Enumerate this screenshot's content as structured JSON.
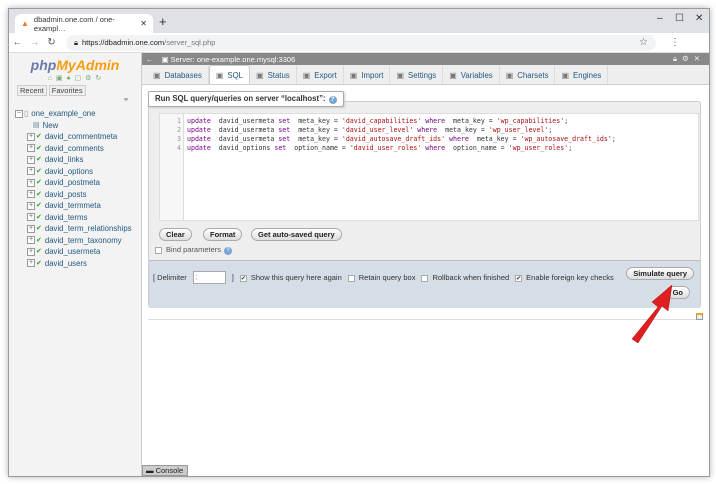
{
  "browser": {
    "tab_title": "dbadmin.one.com / one-exampl…",
    "url_host": "https://dbadmin.one.com",
    "url_path": "/server_sql.php"
  },
  "sidebar": {
    "logo_php": "php",
    "logo_myadmin": "MyAdmin",
    "recent": "Recent",
    "favorites": "Favorites",
    "database": "one_example_one",
    "new_label": "New",
    "tables": [
      "david_commentmeta",
      "david_comments",
      "david_links",
      "david_options",
      "david_postmeta",
      "david_posts",
      "david_termmeta",
      "david_terms",
      "david_term_relationships",
      "david_term_taxonomy",
      "david_usermeta",
      "david_users"
    ]
  },
  "server_bar": {
    "title": "Server: one-example.one.mysql:3306"
  },
  "tabs": [
    {
      "label": "Databases",
      "icon": "database-icon"
    },
    {
      "label": "SQL",
      "icon": "sql-icon",
      "active": true
    },
    {
      "label": "Status",
      "icon": "status-icon"
    },
    {
      "label": "Export",
      "icon": "export-icon"
    },
    {
      "label": "Import",
      "icon": "import-icon"
    },
    {
      "label": "Settings",
      "icon": "wrench-icon"
    },
    {
      "label": "Variables",
      "icon": "variables-icon"
    },
    {
      "label": "Charsets",
      "icon": "charsets-icon"
    },
    {
      "label": "Engines",
      "icon": "engines-icon"
    }
  ],
  "sql": {
    "legend": "Run SQL query/queries on server “localhost”:",
    "lines": [
      [
        [
          "kw",
          "update"
        ],
        [
          "",
          "  david_usermeta "
        ],
        [
          "kw",
          "set"
        ],
        [
          "",
          "  meta_key = "
        ],
        [
          "st",
          "'david_capabilities'"
        ],
        [
          "kw",
          " where"
        ],
        [
          "",
          "  meta_key = "
        ],
        [
          "st",
          "'wp_capabilities'"
        ],
        [
          "",
          ";"
        ]
      ],
      [
        [
          "kw",
          "update"
        ],
        [
          "",
          "  david_usermeta "
        ],
        [
          "kw",
          "set"
        ],
        [
          "",
          "  meta_key = "
        ],
        [
          "st",
          "'david_user_level'"
        ],
        [
          "kw",
          " where"
        ],
        [
          "",
          "  meta_key = "
        ],
        [
          "st",
          "'wp_user_level'"
        ],
        [
          "",
          ";"
        ]
      ],
      [
        [
          "kw",
          "update"
        ],
        [
          "",
          "  david_usermeta "
        ],
        [
          "kw",
          "set"
        ],
        [
          "",
          "  meta_key = "
        ],
        [
          "st",
          "'david_autosave_draft_ids'"
        ],
        [
          "kw",
          " where"
        ],
        [
          "",
          "  meta_key = "
        ],
        [
          "st",
          "'wp_autosave_draft_ids'"
        ],
        [
          "",
          ";"
        ]
      ],
      [
        [
          "kw",
          "update"
        ],
        [
          "",
          "  david_options "
        ],
        [
          "kw",
          "set"
        ],
        [
          "",
          "  option_name = "
        ],
        [
          "st",
          "'david_user_roles'"
        ],
        [
          "kw",
          " where"
        ],
        [
          "",
          "  option_name = "
        ],
        [
          "st",
          "'wp_user_roles'"
        ],
        [
          "",
          ";"
        ]
      ]
    ],
    "clear": "Clear",
    "format": "Format",
    "autosaved": "Get auto-saved query",
    "bind_params": "Bind parameters"
  },
  "options": {
    "delimiter_label": "[ Delimiter",
    "delimiter_value": ";",
    "delimiter_close": "]",
    "show_again": "Show this query here again",
    "show_again_checked": true,
    "retain": "Retain query box",
    "retain_checked": false,
    "rollback": "Rollback when finished",
    "rollback_checked": false,
    "fk": "Enable foreign key checks",
    "fk_checked": true,
    "simulate": "Simulate query",
    "go": "Go"
  },
  "console": "Console",
  "colors": {
    "arrow": "#e02020",
    "options_bg": "#d5dde6"
  }
}
